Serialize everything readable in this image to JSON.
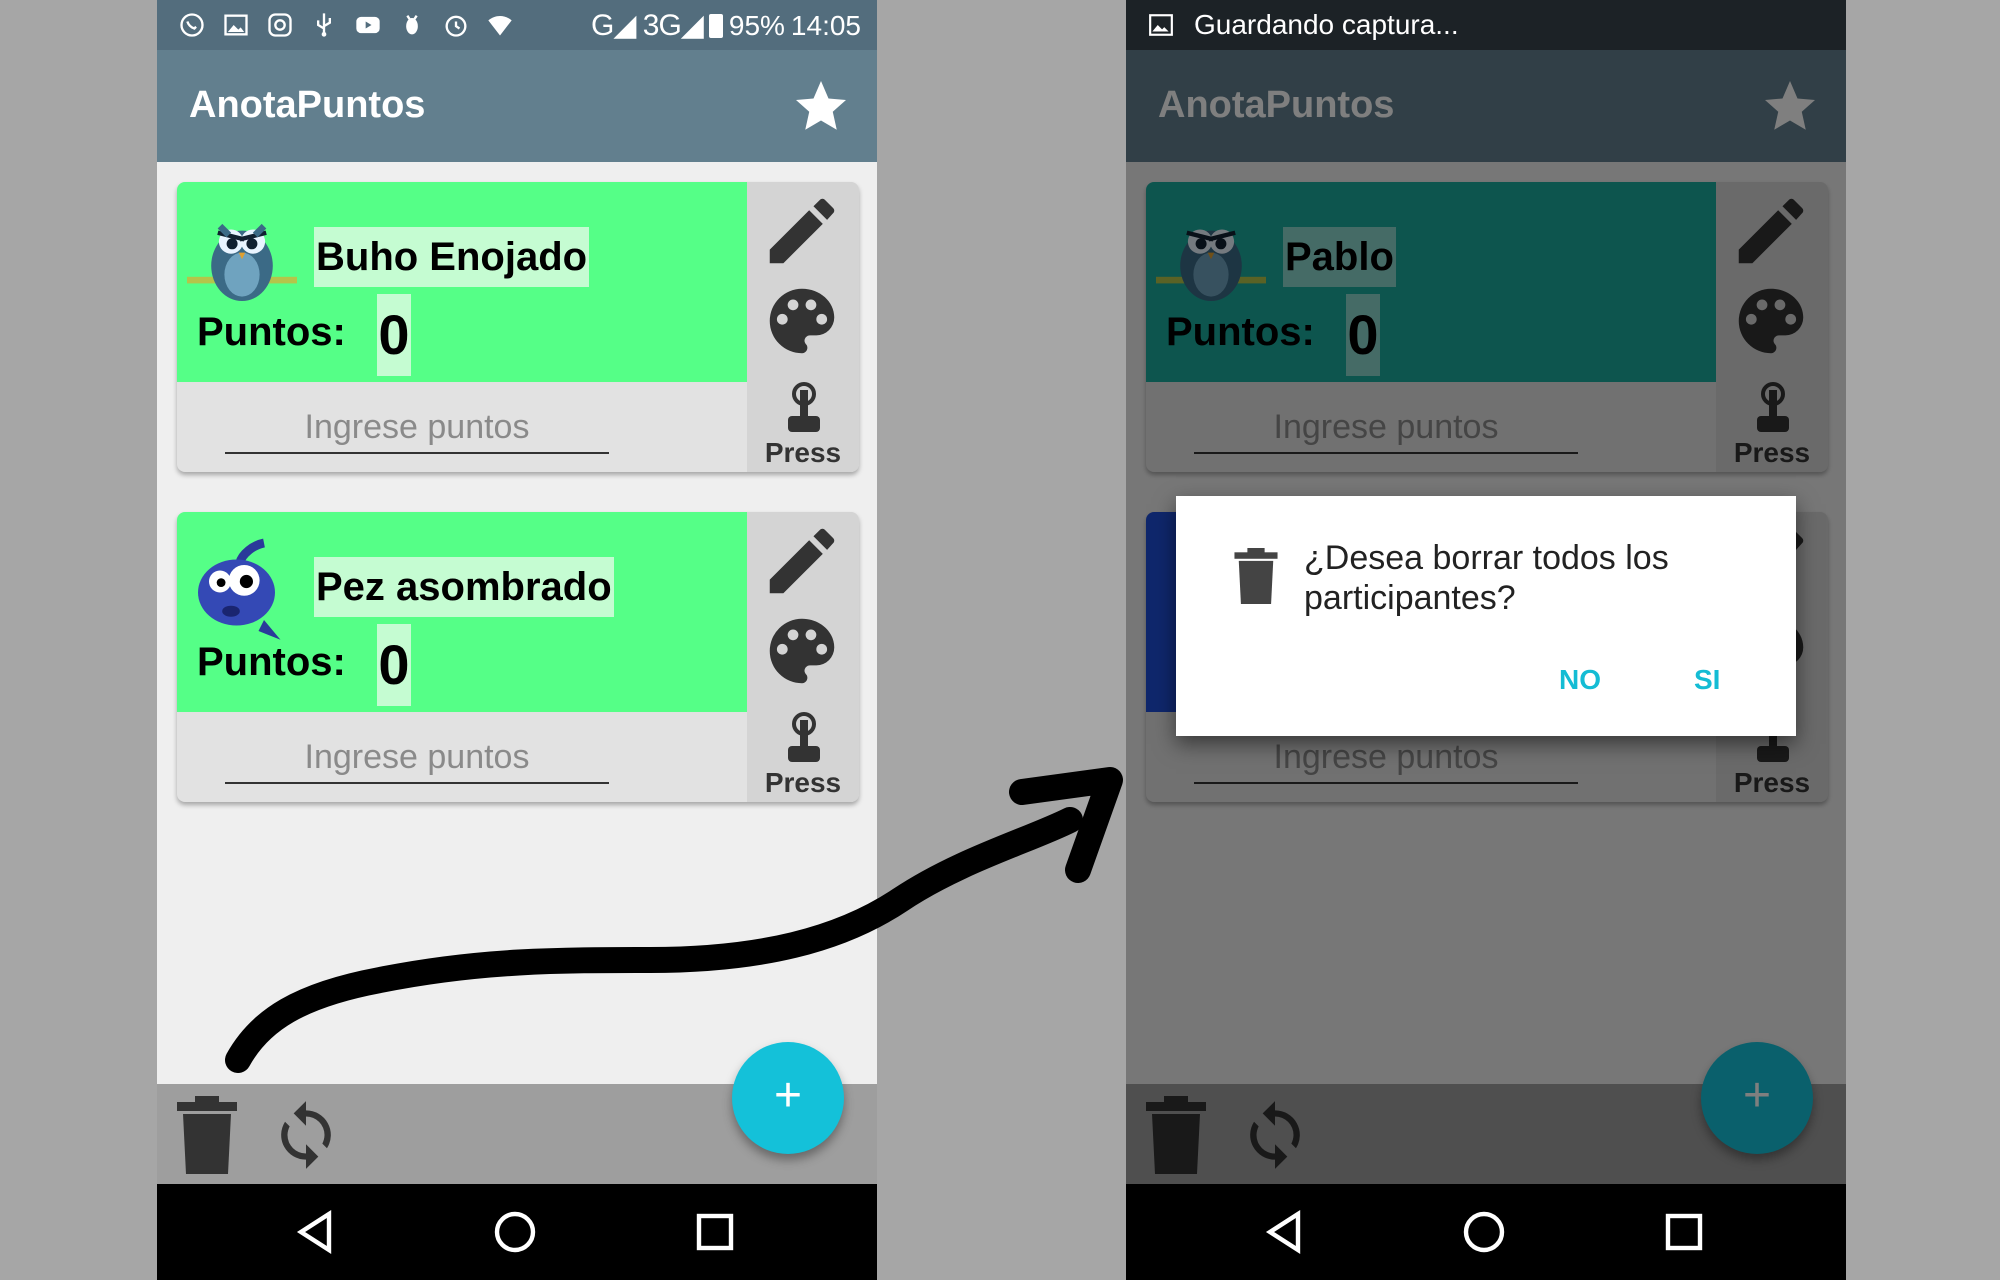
{
  "left_screen": {
    "status": {
      "battery": "95%",
      "time": "14:05",
      "network": "G◢ 3G◢"
    },
    "app_title": "AnotaPuntos",
    "cards": [
      {
        "name": "Buho Enojado",
        "points_label": "Puntos:",
        "points": "0",
        "input_placeholder": "Ingrese puntos",
        "press_label": "Press",
        "avatar": "owl-avatar"
      },
      {
        "name": "Pez asombrado",
        "points_label": "Puntos:",
        "points": "0",
        "input_placeholder": "Ingrese puntos",
        "press_label": "Press",
        "avatar": "fish-avatar"
      }
    ],
    "fab_label": "+"
  },
  "right_screen": {
    "notification": "Guardando captura...",
    "app_title": "AnotaPuntos",
    "cards": [
      {
        "name": "Pablo",
        "points_label": "Puntos:",
        "points": "0",
        "input_placeholder": "Ingrese puntos",
        "press_label": "Press",
        "avatar": "owl-avatar"
      },
      {
        "input_placeholder": "Ingrese puntos",
        "press_label": "Press"
      }
    ],
    "dialog": {
      "message": "¿Desea borrar todos los participantes?",
      "no_label": "NO",
      "yes_label": "SI",
      "icon": "trash-icon"
    },
    "fab_label": "+"
  },
  "colors": {
    "card_green": "#55ff87",
    "card_teal": "#1aaa9c",
    "accent": "#14c1d9",
    "toolbar": "#627f8e"
  }
}
